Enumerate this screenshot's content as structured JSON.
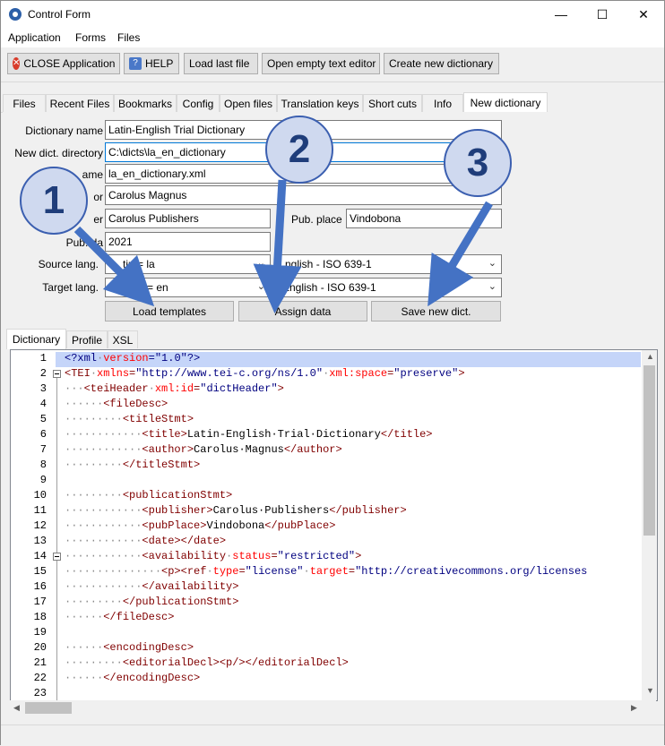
{
  "window": {
    "title": "Control Form",
    "minimize": "—",
    "maximize": "☐",
    "close": "✕"
  },
  "menu": [
    "Application",
    "Forms",
    "Files"
  ],
  "toolbar": {
    "close_app": "CLOSE Application",
    "help": "HELP",
    "load_last": "Load last file",
    "open_empty": "Open empty text editor",
    "create_dict": "Create new dictionary"
  },
  "tabs": [
    "Files",
    "Recent Files",
    "Bookmarks",
    "Config",
    "Open files",
    "Translation keys",
    "Short cuts",
    "Info",
    "New dictionary"
  ],
  "form": {
    "dict_name_label": "Dictionary name",
    "dict_name": "Latin-English Trial Dictionary",
    "dir_label": "New dict. directory",
    "dir": "C:\\dicts\\la_en_dictionary",
    "file_label_visible": "ame",
    "file": "la_en_dictionary.xml",
    "author_label_visible": "or",
    "author": "Carolus Magnus",
    "publisher_label_visible": "er",
    "publisher": "Carolus Publishers",
    "pubplace_label": "Pub. place",
    "pubplace": "Vindobona",
    "pubdate_label_visible": "Pub. da",
    "pubdate": "2021",
    "source_label": "Source lang.",
    "source_visible": "tin = la",
    "source_en": "nglish - ISO 639-1",
    "target_label": "Target lang.",
    "target_visible_a": "E",
    "target_visible_b": "h = en",
    "target_en": "English - ISO 639-1",
    "load_templates": "Load templates",
    "assign_data": "Assign data",
    "save_dict": "Save new dict."
  },
  "subtabs": [
    "Dictionary",
    "Profile",
    "XSL"
  ],
  "editor": {
    "line_numbers": [
      "1",
      "2",
      "3",
      "4",
      "5",
      "6",
      "7",
      "8",
      "9",
      "10",
      "11",
      "12",
      "13",
      "14",
      "15",
      "16",
      "17",
      "18",
      "19",
      "20",
      "21",
      "22",
      "23"
    ]
  },
  "callouts": [
    "1",
    "2",
    "3"
  ],
  "colors": {
    "accent": "#0078d7",
    "callout_fill": "#cfd9ef",
    "callout_border": "#3b5fb0",
    "arrow": "#4472c4"
  }
}
